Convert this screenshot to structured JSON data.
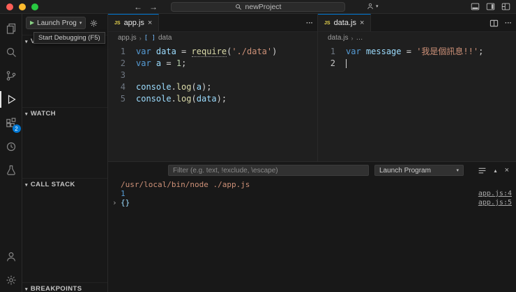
{
  "window": {
    "search_label": "newProject"
  },
  "colors": {
    "accent": "#0078d4",
    "debug_play_green": "#89d185",
    "badge_blue": "#0078d4",
    "traffic_red": "#ff5f57",
    "traffic_yellow": "#febc2e",
    "traffic_green": "#28c840",
    "syntax_keyword": "#569cd6",
    "syntax_variable": "#9cdcfe",
    "syntax_function": "#dcdcaa",
    "syntax_string": "#ce9178",
    "syntax_number": "#b5cea8"
  },
  "activity_bar": {
    "badge_count": "2"
  },
  "sidebar": {
    "run_button_label": "Launch Prog",
    "tooltip": "Start Debugging (F5)",
    "sections": {
      "variables": "VARIABLES",
      "watch": "WATCH",
      "call_stack": "CALL STACK",
      "breakpoints": "BREAKPOINTS"
    }
  },
  "editors": {
    "left": {
      "tab": "app.js",
      "breadcrumb_file": "app.js",
      "breadcrumb_symbol": "data",
      "lines": [
        {
          "n": "1",
          "tokens": [
            [
              "kw",
              "var"
            ],
            [
              "pl",
              " "
            ],
            [
              "var",
              "data"
            ],
            [
              "pl",
              " = "
            ],
            [
              "fn sq",
              "require"
            ],
            [
              "pl",
              "("
            ],
            [
              "str",
              "'./data'"
            ],
            [
              "pl",
              ")"
            ]
          ]
        },
        {
          "n": "2",
          "tokens": [
            [
              "kw",
              "var"
            ],
            [
              "pl",
              " "
            ],
            [
              "var",
              "a"
            ],
            [
              "pl",
              " = "
            ],
            [
              "num",
              "1"
            ],
            [
              "pl",
              ";"
            ]
          ]
        },
        {
          "n": "3",
          "tokens": []
        },
        {
          "n": "4",
          "tokens": [
            [
              "var",
              "console"
            ],
            [
              "pl",
              "."
            ],
            [
              "fn",
              "log"
            ],
            [
              "pl",
              "("
            ],
            [
              "var",
              "a"
            ],
            [
              "pl",
              ");"
            ]
          ]
        },
        {
          "n": "5",
          "tokens": [
            [
              "var",
              "console"
            ],
            [
              "pl",
              "."
            ],
            [
              "fn",
              "log"
            ],
            [
              "pl",
              "("
            ],
            [
              "var",
              "data"
            ],
            [
              "pl",
              ");"
            ]
          ]
        }
      ]
    },
    "right": {
      "tab": "data.js",
      "breadcrumb_file": "data.js",
      "breadcrumb_symbol": "…",
      "lines": [
        {
          "n": "1",
          "tokens": [
            [
              "kw",
              "var"
            ],
            [
              "pl",
              " "
            ],
            [
              "var",
              "message"
            ],
            [
              "pl",
              " = "
            ],
            [
              "str",
              "'我是個訊息!!'"
            ],
            [
              "pl",
              ";"
            ]
          ]
        },
        {
          "n": "2",
          "tokens": [],
          "cursor": true,
          "active": true
        }
      ]
    }
  },
  "panel": {
    "filter_placeholder": "Filter (e.g. text, !exclude, \\escape)",
    "config_dropdown": "Launch Program",
    "output": [
      {
        "text": "/usr/local/bin/node ./app.js",
        "link": ""
      },
      {
        "text": "1",
        "link": "app.js:4"
      },
      {
        "text": "{}",
        "link": "app.js:5"
      }
    ]
  }
}
